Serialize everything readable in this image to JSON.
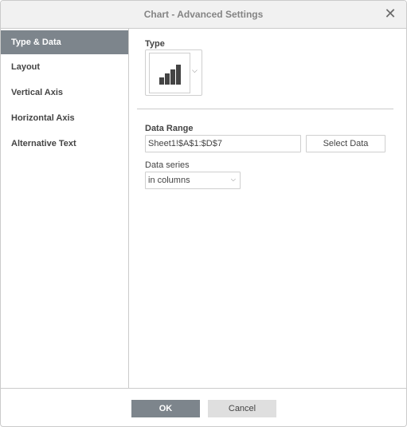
{
  "dialog": {
    "title": "Chart - Advanced Settings",
    "close_icon": "close-icon"
  },
  "sidebar": {
    "items": [
      {
        "label": "Type & Data",
        "active": true
      },
      {
        "label": "Layout",
        "active": false
      },
      {
        "label": "Vertical Axis",
        "active": false
      },
      {
        "label": "Horizontal Axis",
        "active": false
      },
      {
        "label": "Alternative Text",
        "active": false
      }
    ]
  },
  "type_section": {
    "label": "Type",
    "selected_type_icon": "column-chart-icon"
  },
  "data_range": {
    "label": "Data Range",
    "value": "Sheet1!$A$1:$D$7",
    "select_button": "Select Data"
  },
  "data_series": {
    "label": "Data series",
    "selected": "in columns"
  },
  "footer": {
    "ok": "OK",
    "cancel": "Cancel"
  },
  "colors": {
    "accent": "#7d858c",
    "cancel_bg": "#dfdfdf",
    "titlebar_bg": "#f1f1f1",
    "border": "#cbcbcb"
  }
}
